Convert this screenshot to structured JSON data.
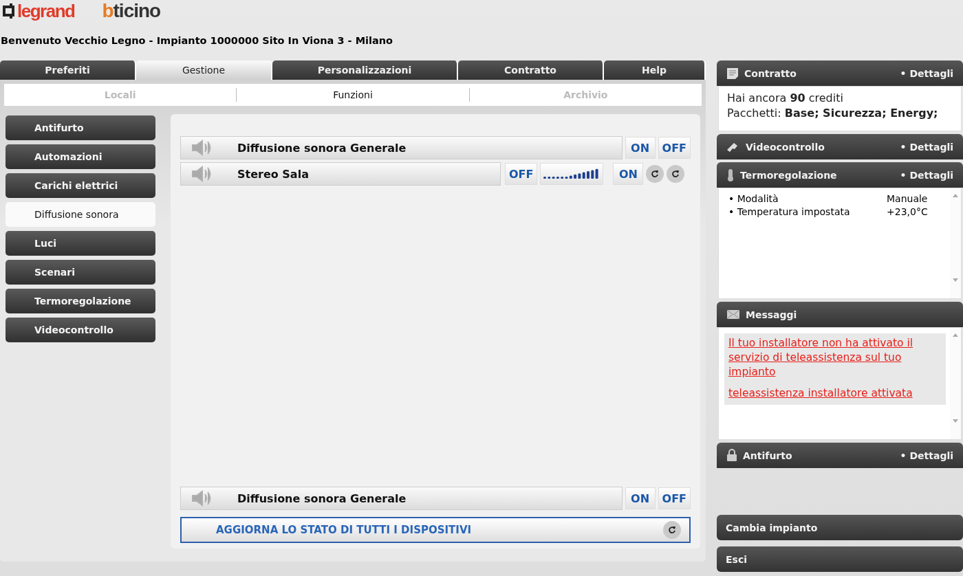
{
  "brand": {
    "legrand": "legrand",
    "bticino": "bticino"
  },
  "welcome": "Benvenuto Vecchio Legno - Impianto 1000000 Sito In Viona 3 - Milano",
  "tabs": [
    {
      "label": "Preferiti",
      "selected": false
    },
    {
      "label": "Gestione",
      "selected": true
    },
    {
      "label": "Personalizzazioni",
      "selected": false
    },
    {
      "label": "Contratto",
      "selected": false
    },
    {
      "label": "Help",
      "selected": false
    }
  ],
  "subtabs": [
    {
      "label": "Locali",
      "selected": false,
      "disabled": true
    },
    {
      "label": "Funzioni",
      "selected": true,
      "disabled": false
    },
    {
      "label": "Archivio",
      "selected": false,
      "disabled": true
    }
  ],
  "sidebar": {
    "items": [
      {
        "label": "Antifurto",
        "selected": false
      },
      {
        "label": "Automazioni",
        "selected": false
      },
      {
        "label": "Carichi elettrici",
        "selected": false
      },
      {
        "label": "Diffusione sonora",
        "selected": true
      },
      {
        "label": "Luci",
        "selected": false
      },
      {
        "label": "Scenari",
        "selected": false
      },
      {
        "label": "Termoregolazione",
        "selected": false
      },
      {
        "label": "Videocontrollo",
        "selected": false
      }
    ]
  },
  "devices": [
    {
      "name": "Diffusione sonora Generale",
      "controls": [
        {
          "kind": "button",
          "label": "ON"
        },
        {
          "kind": "button",
          "label": "OFF"
        }
      ]
    },
    {
      "name": "Stereo Sala",
      "controls": [
        {
          "kind": "button",
          "label": "OFF"
        },
        {
          "kind": "volume"
        },
        {
          "kind": "button",
          "label": "ON"
        },
        {
          "kind": "refresh"
        },
        {
          "kind": "refresh"
        }
      ]
    }
  ],
  "footer_device": {
    "name": "Diffusione sonora Generale",
    "controls": [
      {
        "kind": "button",
        "label": "ON"
      },
      {
        "kind": "button",
        "label": "OFF"
      }
    ]
  },
  "refresh_all": "AGGIORNA LO STATO DI TUTTI I DISPOSITIVI",
  "widgets": [
    {
      "kind": "contract",
      "title": "Contratto",
      "link": "• Dettagli",
      "lines": [
        "Hai ancora **90** crediti",
        "Pacchetti: **Base; Sicurezza; Energy;**"
      ]
    },
    {
      "kind": "header",
      "title": "Videocontrollo",
      "link": "• Dettagli"
    },
    {
      "kind": "list",
      "title": "Termoregolazione",
      "link": "• Dettagli",
      "rows": [
        {
          "label": "• Modalità",
          "value": "Manuale"
        },
        {
          "label": "• Temperatura impostata",
          "value": "+23,0°C"
        }
      ]
    },
    {
      "kind": "messages",
      "title": "Messaggi",
      "messages": [
        "Il tuo installatore non ha attivato il servizio di teleassistenza sul tuo impianto",
        "teleassistenza installatore attivata"
      ]
    },
    {
      "kind": "header",
      "title": "Antifurto",
      "link": "• Dettagli"
    }
  ],
  "bottom_buttons": [
    "Cambia impianto",
    "Esci"
  ]
}
